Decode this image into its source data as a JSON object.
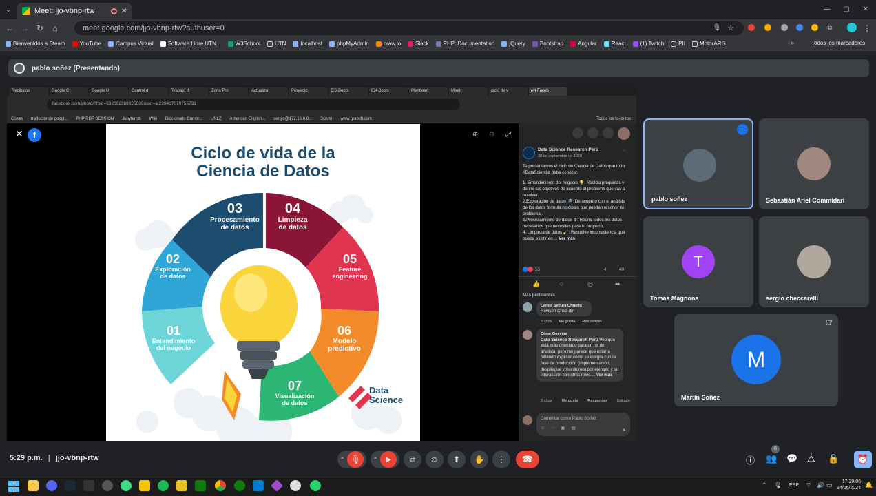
{
  "browser": {
    "tab_title": "Meet: jjo-vbnp-rtw",
    "url": "meet.google.com/jjo-vbnp-rtw?authuser=0",
    "bookmarks": [
      "Bienvenidos a Steam",
      "YouTube",
      "Campus Virtual",
      "Software Libre UTN...",
      "W3School",
      "UTN",
      "localhost",
      "phpMyAdmin",
      "draw.io",
      "Slack",
      "PHP: Documentation",
      "jQuery",
      "Bootstrap",
      "Angular",
      "React",
      "(1) Twitch",
      "PII",
      "MotorARG"
    ],
    "all_bookmarks": "Todos los marcadores"
  },
  "meet": {
    "presenter": "pablo soñez (Presentando)",
    "time": "5:29 p.m.",
    "code": "jjo-vbnp-rtw",
    "people_count": "6"
  },
  "shared": {
    "inner_tabs": [
      "Recibidos",
      "Google C",
      "Google U",
      "Control d",
      "Trabajo d",
      "Zona Pro",
      "Actualiza",
      "Proyecto",
      "ES-Boots",
      "EN-Boots",
      "Merlbean",
      "Meet",
      "ciclo de v",
      "(4) Faceb"
    ],
    "inner_url": "facebook.com/photo/?fbid=632092388826539&set=a.239467079755731",
    "inner_bookmarks": [
      "Cosas",
      "traductor de googl...",
      "PHP RDP SESSION",
      "Jupyter.sb",
      "Wiki",
      "Diccionario Cambr...",
      "UNLZ",
      "American English...",
      "sergio@172.16.6.8...",
      "Scrum",
      "www.grabcfl.com"
    ],
    "inner_all_bm": "Todos los favoritos",
    "infographic": {
      "title1": "Ciclo de vida de la",
      "title2": "Ciencia de Datos",
      "steps": [
        {
          "num": "01",
          "label1": "Entendimiento",
          "label2": "del negocio"
        },
        {
          "num": "02",
          "label1": "Exploración",
          "label2": "de datos"
        },
        {
          "num": "03",
          "label1": "Procesamiento",
          "label2": "de datos"
        },
        {
          "num": "04",
          "label1": "Limpieza",
          "label2": "de datos"
        },
        {
          "num": "05",
          "label1": "Feature",
          "label2": "engineering"
        },
        {
          "num": "06",
          "label1": "Modelo",
          "label2": "predictivo"
        },
        {
          "num": "07",
          "label1": "Visualización",
          "label2": "de datos"
        }
      ],
      "brand1": "Data",
      "brand2": "Science"
    },
    "fb": {
      "page_name": "Data Science Research Perú",
      "date": "30 de septiembre de 2020",
      "post": "Te presentamos el ciclo de Ciencia de Datos que todo #DataScientist debe conocer:",
      "item1": "1. Entendimiento del negocio 💡: Realiza preguntas y define tus objetivos de acuerdo al problema que vas a resolver.",
      "item2": "2.Exploración de datos 🔎: De acuerdo con el análisis de los datos formula hipótesis que puedan resolver tu problema .",
      "item3": "3.Procesamiento de datos ⚙: Reúne todos los datos necesarios que necesites para tu proyecto.",
      "item4": "4. Limpieza de datos 🧹: Resuelve inconsistencia que pueda existir en ...",
      "see_more": "Ver más",
      "reactions": "53",
      "comments_count": "4",
      "shares_count": "40",
      "sort": "Más pertinentes",
      "c1_name": "Carlos Segura Ormeño",
      "c1_text": "Revisen Crisp-dm",
      "c1_meta": "3 años",
      "like": "Me gusta",
      "reply": "Responder",
      "c2_name": "César Guevara",
      "c2_text_tag": "Data Science Research Perú",
      "c2_text": "Veo que está más orientado para un rol de analista, pero me parece que estaría faltando explicar cómo se integra con la fase de producción (implementación, despliegue y monitoreo) por ejemplo y su interacción con otros roles....",
      "c2_more": "Ver más",
      "c2_meta": "3 años",
      "edited": "Editado",
      "comment_placeholder": "Comentar como Pablo Soñez"
    }
  },
  "participants": [
    {
      "name": "pablo soñez",
      "initial": ""
    },
    {
      "name": "Sebastián Ariel Commidari",
      "initial": ""
    },
    {
      "name": "Tomas Magnone",
      "initial": "T",
      "color": "#a142f4"
    },
    {
      "name": "sergio checcarelli",
      "initial": ""
    },
    {
      "name": "Martín Soñez",
      "initial": "M",
      "color": "#1a73e8"
    }
  ],
  "system": {
    "lang": "ESP",
    "clock": "17:29:06",
    "date": "14/06/2024"
  }
}
